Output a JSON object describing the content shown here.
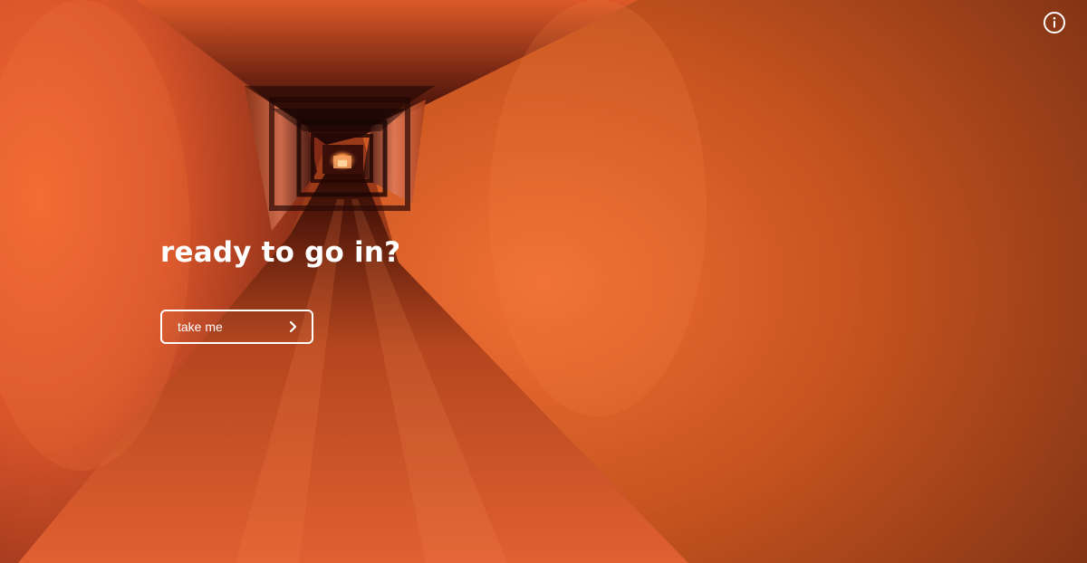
{
  "scene": {
    "name": "orange-tunnel",
    "colors": {
      "bright": "#f06a32",
      "mid": "#c4491e",
      "dark": "#3a0f08",
      "glow": "#ffb070"
    }
  },
  "header": {
    "info_icon": "info-icon"
  },
  "hero": {
    "headline": "ready to go in?",
    "button_label": "take me",
    "button_icon": "chevron-right-icon"
  }
}
